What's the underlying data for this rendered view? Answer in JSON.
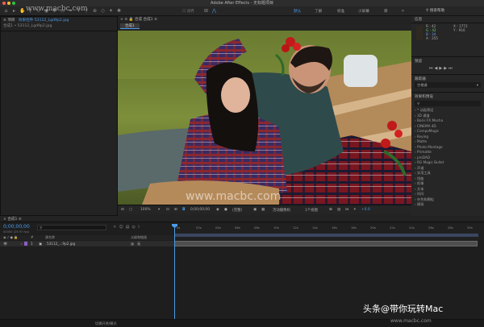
{
  "window": {
    "title": "Adobe After Effects - 无标题项目"
  },
  "toolbar": {
    "snap_label": "对齐",
    "workspaces": [
      "默认",
      "了解",
      "标准",
      "小屏幕",
      "库"
    ],
    "search_label": "搜索帮助"
  },
  "project_panel": {
    "tab_label": "项目",
    "effects_tab_label": "效果控件 53112_Lgd9p2.jpg",
    "item_label": "合成1 • 53112_Lgd9p2.jpg"
  },
  "viewer": {
    "tab_label": "合成 合成1",
    "comp_button_label": "合成1",
    "zoom": "100%",
    "timecode": "0;00;00;00",
    "resolution": "(完整)",
    "camera": "活动摄像机",
    "views": "1个视图",
    "exposure": "+0.0"
  },
  "info_panel": {
    "title": "信息",
    "r_label": "R :",
    "r_value": "42",
    "g_label": "G :",
    "g_value": "42",
    "b_label": "B :",
    "b_value": "34",
    "a_label": "A :",
    "a_value": "255",
    "x_label": "X :",
    "x_value": "1772",
    "y_label": "Y :",
    "y_value": "916"
  },
  "preview_panel": {
    "title": "预览"
  },
  "align_panel": {
    "title": "跟踪器",
    "dropdown": "空格键"
  },
  "effects_panel": {
    "title": "效果和预设",
    "search_placeholder": "",
    "items": [
      "* 动画预设",
      "3D 通道",
      "Boris FX Mocha",
      "CINEMA 4D",
      "CompoMagic",
      "Keying",
      "Matte",
      "Photo Montage",
      "Primatte",
      "proDAD",
      "RG Magic Bullet",
      "声道",
      "实用工具",
      "扭曲",
      "抠像",
      "文本",
      "时间",
      "杂色和颗粒",
      "模拟"
    ]
  },
  "timeline": {
    "tab_label": "合成1",
    "timecode": "0;00;00;00",
    "fps_info": "00000 (29.97 fps)",
    "search_placeholder": "",
    "col_source": "源名称",
    "col_parent": "父级和链接",
    "layer_number": "1",
    "layer_name": "53112_...9p2.jpg",
    "parent_value": "无",
    "footer_label": "切换开关/模式",
    "ruler": [
      "0s",
      "02s",
      "04s",
      "06s",
      "08s",
      "10s",
      "12s",
      "14s",
      "16s",
      "18s",
      "20s",
      "22s",
      "24s",
      "26s",
      "28s",
      "30s"
    ]
  },
  "watermarks": {
    "top": "www.macbc.com",
    "mid": "www.macbc.com",
    "bottom_brand": "头条",
    "bottom_author": "@带你玩转Mac",
    "bottom_site": "www.macbc.com"
  },
  "colors": {
    "accent": "#4a9ce8",
    "panel": "#232323",
    "bg": "#1b1b1b"
  }
}
